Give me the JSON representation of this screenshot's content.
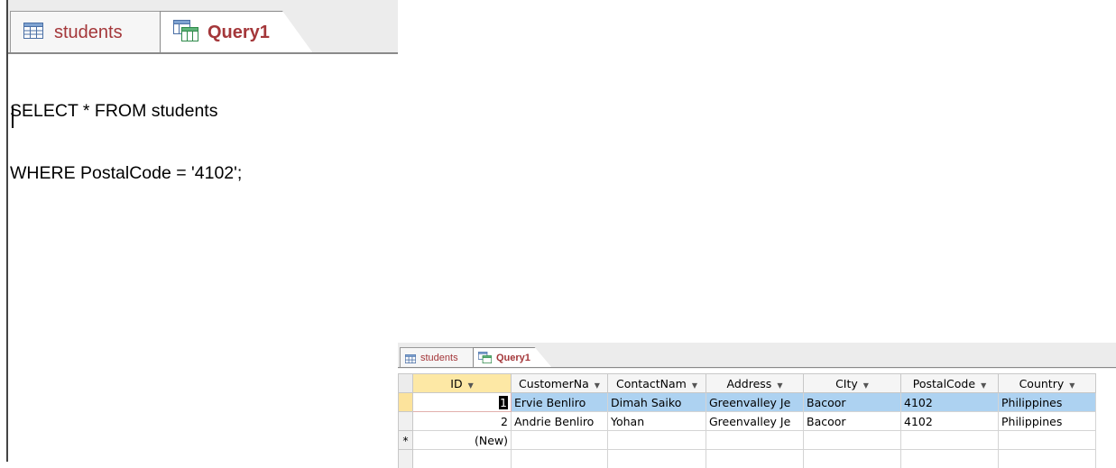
{
  "sql_view": {
    "tabs": [
      {
        "label": "students",
        "icon": "table-icon"
      },
      {
        "label": "Query1",
        "icon": "query-icon"
      }
    ],
    "sql_lines": [
      "SELECT * FROM students",
      "WHERE PostalCode = '4102';"
    ]
  },
  "datasheet": {
    "tabs": [
      {
        "label": "students",
        "icon": "table-icon"
      },
      {
        "label": "Query1",
        "icon": "query-icon"
      }
    ],
    "columns": [
      "ID",
      "CustomerNa",
      "ContactNam",
      "Address",
      "CIty",
      "PostalCode",
      "Country"
    ],
    "rows": [
      {
        "id": "1",
        "customer": "Ervie Benliro",
        "contact": "Dimah Saiko",
        "address": "Greenvalley Je",
        "city": "Bacoor",
        "postal": "4102",
        "country": "Philippines"
      },
      {
        "id": "2",
        "customer": "Andrie Benliro",
        "contact": "Yohan",
        "address": "Greenvalley Je",
        "city": "Bacoor",
        "postal": "4102",
        "country": "Philippines"
      }
    ],
    "new_row_label": "(New)",
    "new_row_marker": "*"
  }
}
